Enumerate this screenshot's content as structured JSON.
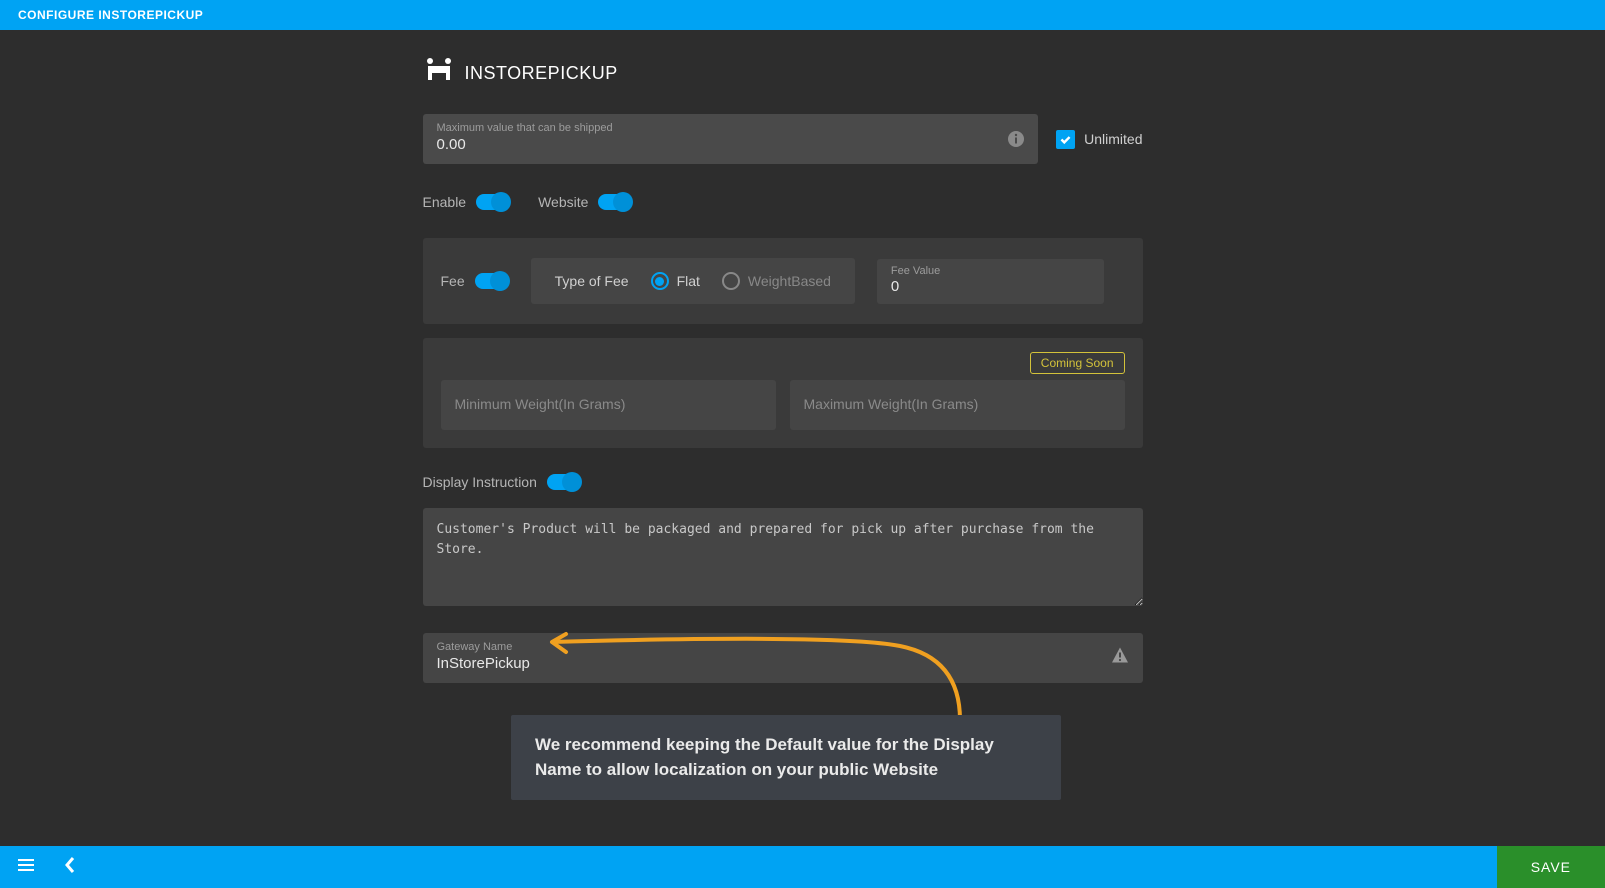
{
  "header": {
    "breadcrumb": "CONFIGURE INSTOREPICKUP"
  },
  "page": {
    "title": "INSTOREPICKUP"
  },
  "maxValue": {
    "label": "Maximum value that can be shipped",
    "value": "0.00",
    "unlimitedLabel": "Unlimited",
    "unlimitedChecked": true
  },
  "toggles": {
    "enableLabel": "Enable",
    "websiteLabel": "Website"
  },
  "fee": {
    "label": "Fee",
    "typeLabel": "Type of Fee",
    "options": {
      "flat": "Flat",
      "weight": "WeightBased"
    },
    "valueLabel": "Fee Value",
    "value": "0"
  },
  "weight": {
    "comingSoon": "Coming Soon",
    "minPlaceholder": "Minimum Weight(In Grams)",
    "maxPlaceholder": "Maximum Weight(In Grams)"
  },
  "instruction": {
    "label": "Display Instruction",
    "text": "Customer's Product will be packaged and prepared for pick up after purchase from the Store."
  },
  "gateway": {
    "label": "Gateway Name",
    "value": "InStorePickup"
  },
  "callout": {
    "text": "We recommend keeping the Default value for the Display Name to allow localization on your public Website"
  },
  "footer": {
    "save": "SAVE"
  }
}
